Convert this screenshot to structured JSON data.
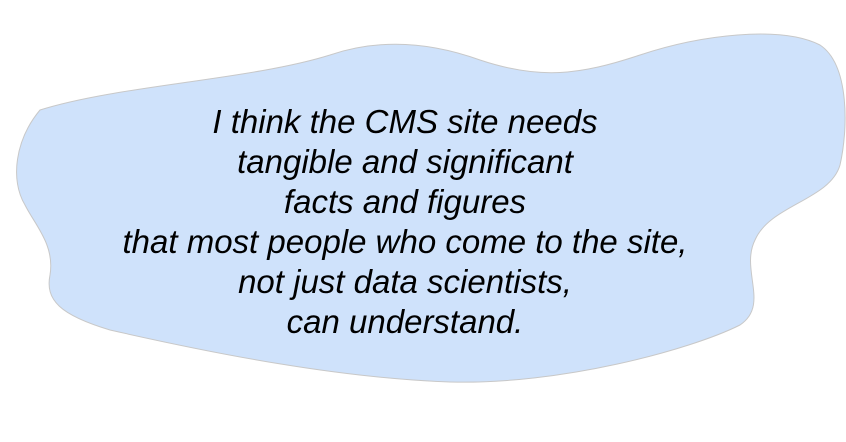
{
  "bubble": {
    "fill_color": "#cfe2fb",
    "stroke_color": "#c8c8c8",
    "lines": [
      "I think the CMS site needs",
      "tangible and significant",
      "facts and figures",
      "that most people who come to the site,",
      "not just data scientists,",
      "can understand."
    ]
  }
}
